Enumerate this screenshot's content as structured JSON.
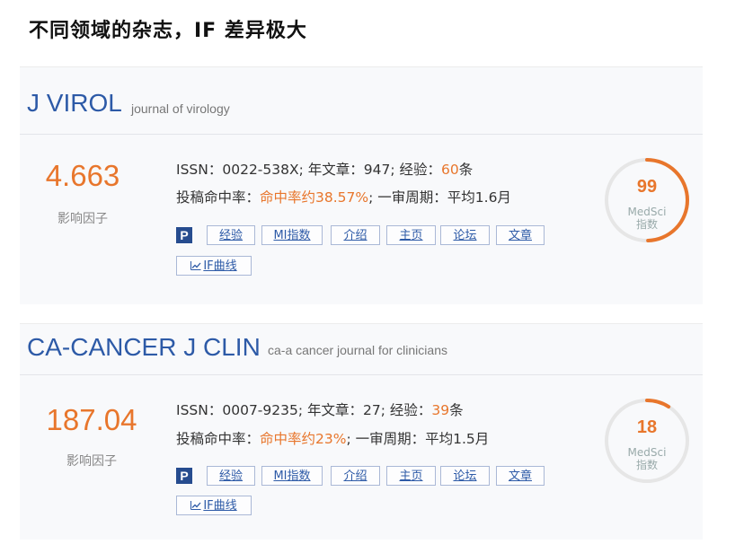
{
  "page": {
    "heading": "不同领域的杂志，IF 差异极大"
  },
  "labels": {
    "impact_factor": "影响因子",
    "issn_prefix": "ISSN：",
    "articles_prefix": "; 年文章：",
    "experience_prefix": "; 经验：",
    "experience_suffix": "条",
    "acceptance_prefix": "投稿命中率：",
    "cycle_prefix": "; 一审周期：",
    "medsci_line1": "MedSci",
    "medsci_line2": "指数"
  },
  "buttons": {
    "pubmed": "P",
    "experience": "经验",
    "mi_index": "MI指数",
    "intro": "介绍",
    "homepage": "主页",
    "forum": "论坛",
    "articles": "文章",
    "if_curve": "IF曲线"
  },
  "colors": {
    "accent_orange": "#e8762c",
    "title_blue": "#2d5aa7",
    "ring_track": "#e6e6e6"
  },
  "journals": [
    {
      "abbr": "J VIROL",
      "full_name": "journal of virology",
      "impact_factor": "4.663",
      "issn": "0022-538X",
      "articles_per_year": "947",
      "experience_count": "60",
      "acceptance": "命中率约38.57%",
      "review_cycle": "平均1.6月",
      "medsci_score": 99,
      "medsci_score_text": "99"
    },
    {
      "abbr": "CA-CANCER J CLIN",
      "full_name": "ca-a cancer journal for clinicians",
      "impact_factor": "187.04",
      "issn": "0007-9235",
      "articles_per_year": "27",
      "experience_count": "39",
      "acceptance": "命中率约23%",
      "review_cycle": "平均1.5月",
      "medsci_score": 18,
      "medsci_score_text": "18"
    }
  ]
}
